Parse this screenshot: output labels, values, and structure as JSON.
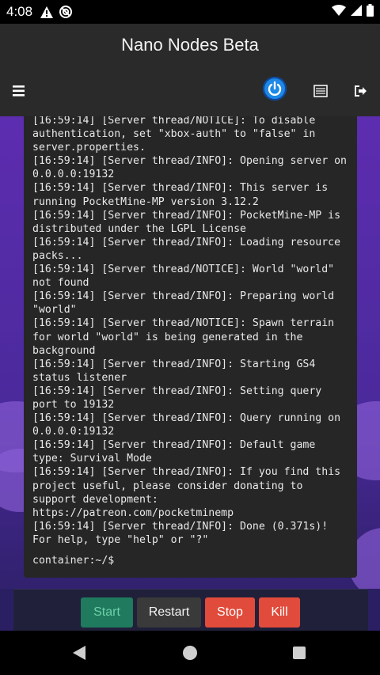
{
  "status_bar": {
    "time": "4:08",
    "icons": [
      "alert-icon",
      "do-not-disturb-icon",
      "wifi-icon",
      "battery-icon"
    ]
  },
  "app_bar": {
    "title": "Nano Nodes Beta",
    "icons": [
      "hamburger-menu-icon",
      "power-icon",
      "console-icon",
      "logout-icon"
    ]
  },
  "console": {
    "log": "[16:59:14] [Server thread/NOTICE]: To disable authentication, set \"xbox-auth\" to \"false\" in server.properties.\n[16:59:14] [Server thread/INFO]: Opening server on 0.0.0.0:19132\n[16:59:14] [Server thread/INFO]: This server is running PocketMine-MP version 3.12.2\n[16:59:14] [Server thread/INFO]: PocketMine-MP is distributed under the LGPL License\n[16:59:14] [Server thread/INFO]: Loading resource packs...\n[16:59:14] [Server thread/NOTICE]: World \"world\" not found\n[16:59:14] [Server thread/INFO]: Preparing world \"world\"\n[16:59:14] [Server thread/NOTICE]: Spawn terrain for world \"world\" is being generated in the background\n[16:59:14] [Server thread/INFO]: Starting GS4 status listener\n[16:59:14] [Server thread/INFO]: Setting query port to 19132\n[16:59:14] [Server thread/INFO]: Query running on 0.0.0.0:19132\n[16:59:14] [Server thread/INFO]: Default game type: Survival Mode\n[16:59:14] [Server thread/INFO]: If you find this project useful, please consider donating to support development: https://patreon.com/pocketminemp\n[16:59:14] [Server thread/INFO]: Done (0.371s)! For help, type \"help\" or \"?\"",
    "prompt": "container:~/$"
  },
  "actions": {
    "start_label": "Start",
    "restart_label": "Restart",
    "stop_label": "Stop",
    "kill_label": "Kill"
  },
  "colors": {
    "start": "#1f7a5e",
    "restart": "#3a3a3a",
    "stop": "#e14b3b",
    "kill": "#e14b3b",
    "power_accent": "#1e88e5"
  },
  "nav_bar": {
    "icons": [
      "back-icon",
      "home-icon",
      "recents-icon"
    ]
  }
}
